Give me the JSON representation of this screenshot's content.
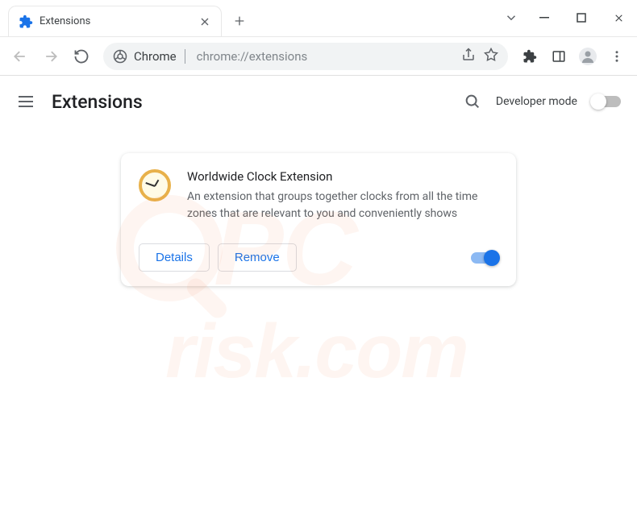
{
  "window": {
    "tab_title": "Extensions"
  },
  "omnibox": {
    "scheme_label": "Chrome",
    "url": "chrome://extensions"
  },
  "page": {
    "title": "Extensions",
    "developer_mode_label": "Developer mode",
    "developer_mode_enabled": false
  },
  "extension": {
    "name": "Worldwide Clock Extension",
    "description": "An extension that groups together clocks from all the time zones that are relevant to you and conveniently shows",
    "details_label": "Details",
    "remove_label": "Remove",
    "enabled": true
  },
  "watermark": "PC\nrisk.com"
}
